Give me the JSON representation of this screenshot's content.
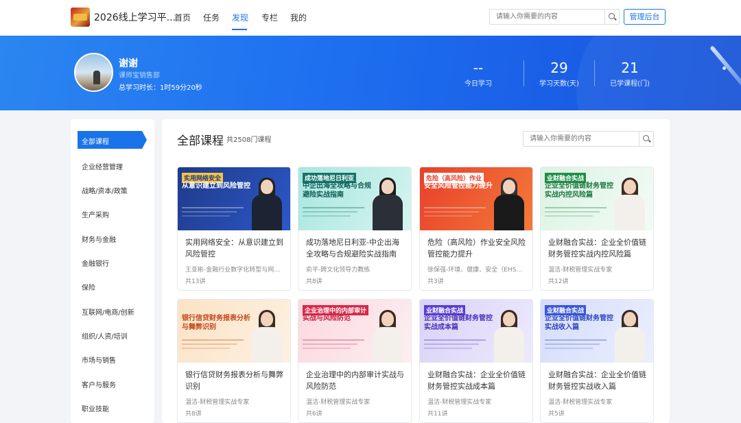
{
  "nav": {
    "site_title": "2026线上学习平...",
    "items": [
      "首页",
      "任务",
      "发现",
      "专栏",
      "我的"
    ],
    "active_index": 2,
    "search_placeholder": "请输入你需要的内容",
    "admin_label": "管理后台"
  },
  "profile": {
    "name": "谢谢",
    "dept": "课师宝销售部",
    "study_time": "总学习时长：1时59分20秒",
    "stats": [
      {
        "value": "--",
        "label": "今日学习"
      },
      {
        "value": "29",
        "label": "学习天数(天)"
      },
      {
        "value": "21",
        "label": "已学课程(门)"
      }
    ]
  },
  "sidebar": {
    "active_index": 0,
    "items": [
      "全部课程",
      "企业经营管理",
      "战略/资本/政策",
      "生产采购",
      "财务与金融",
      "金融银行",
      "保险",
      "互联网/电商/创新",
      "组织/人资/培训",
      "市场与销售",
      "客户与服务",
      "职业技能"
    ]
  },
  "main": {
    "title": "全部课程",
    "count": "共2508门课程",
    "search_placeholder": "请输入你需要的内容"
  },
  "courses": [
    {
      "title": "实用网络安全：从意识建立到风险管控",
      "author": "王亚彬-金融行业数字化转型与网络信...",
      "lessons": "共13讲",
      "thumb_tag": "实用网络安全",
      "thumb_title": "从意识建立到风险管控",
      "theme": {
        "bg": "#1f3a8a",
        "bg2": "#2c58c8",
        "tag_bg": "#f5c542",
        "tag_fg": "#1f3a8a",
        "fg": "#ffffff",
        "body": "#1c2333",
        "hair": "#222222"
      }
    },
    {
      "title": "成功落地尼日利亚-中企出海全攻略与合规避险实战指南",
      "author": "俞平-跨文化领导力教练",
      "lessons": "共8讲",
      "thumb_tag": "成功落地尼日利亚",
      "thumb_title": "中企出海全攻略与合规避险实战指南",
      "theme": {
        "bg": "#a8e6e0",
        "bg2": "#d6f4ef",
        "tag_bg": "#15756b",
        "tag_fg": "#ffffff",
        "fg": "#0f5e55",
        "body": "#2a2f38",
        "hair": "#1c1c1c"
      }
    },
    {
      "title": "危险（高风险）作业安全风险管控能力提升",
      "author": "徐保强-环境、健康、安全（EHS）引...",
      "lessons": "共3讲",
      "thumb_tag": "危险（高风险）作业",
      "thumb_title": "安全风险管控能力提升",
      "theme": {
        "bg": "#e8402a",
        "bg2": "#f37a3a",
        "tag_bg": "#ffffff",
        "tag_fg": "#e8402a",
        "fg": "#ffffff",
        "body": "#1a1a1a",
        "hair": "#333333"
      }
    },
    {
      "title": "业财融合实战：企业全价值链财务管控实战内控风险篇",
      "author": "温洁-财税管理实战专家",
      "lessons": "共12讲",
      "thumb_tag": "业财融合实战",
      "thumb_title": "企业全价值链财务管控实战内控风险篇",
      "theme": {
        "bg": "#dcf3e3",
        "bg2": "#f2fbf5",
        "tag_bg": "#1f8f4a",
        "tag_fg": "#ffffff",
        "fg": "#1f7a3f",
        "body": "#f3f0ec",
        "hair": "#3b2a22"
      }
    },
    {
      "title": "银行信贷财务报表分析与舞弊识别",
      "author": "温洁-财税管理实战专家",
      "lessons": "共8讲",
      "thumb_tag": "",
      "thumb_title": "银行信贷财务报表分析与舞弊识别",
      "theme": {
        "bg": "#fbe3c5",
        "bg2": "#fdf1e2",
        "tag_bg": "#c5560f",
        "tag_fg": "#ffffff",
        "fg": "#c0481a",
        "body": "#f3f0ec",
        "hair": "#3b2a22"
      }
    },
    {
      "title": "企业治理中的内部审计实战与风险防范",
      "author": "温洁-财税管理实战专家",
      "lessons": "共6讲",
      "thumb_tag": "企业治理中的内部审计",
      "thumb_title": "实战与风险防范",
      "theme": {
        "bg": "#fbd9e0",
        "bg2": "#fdeef1",
        "tag_bg": "#d8294a",
        "tag_fg": "#ffffff",
        "fg": "#c8213f",
        "body": "#f3f0ec",
        "hair": "#3b2a22"
      }
    },
    {
      "title": "业财融合实战：企业全价值链财务管控实战成本篇",
      "author": "温洁-财税管理实战专家",
      "lessons": "共11讲",
      "thumb_tag": "业财融合实战",
      "thumb_title": "企业全价值链财务管控实战成本篇",
      "theme": {
        "bg": "#d9d2f7",
        "bg2": "#eeeafd",
        "tag_bg": "#5a3fd0",
        "tag_fg": "#ffffff",
        "fg": "#4a32b8",
        "body": "#f3f0ec",
        "hair": "#3b2a22"
      }
    },
    {
      "title": "业财融合实战：企业全价值链财务管控实战收入篇",
      "author": "温洁-财税管理实战专家",
      "lessons": "共5讲",
      "thumb_tag": "业财融合实战",
      "thumb_title": "企业全价值链财务管控实战收入篇",
      "theme": {
        "bg": "#d4dcfb",
        "bg2": "#ebeffe",
        "tag_bg": "#3a58d8",
        "tag_fg": "#ffffff",
        "fg": "#2e48c0",
        "body": "#f3f0ec",
        "hair": "#3b2a22"
      }
    }
  ]
}
